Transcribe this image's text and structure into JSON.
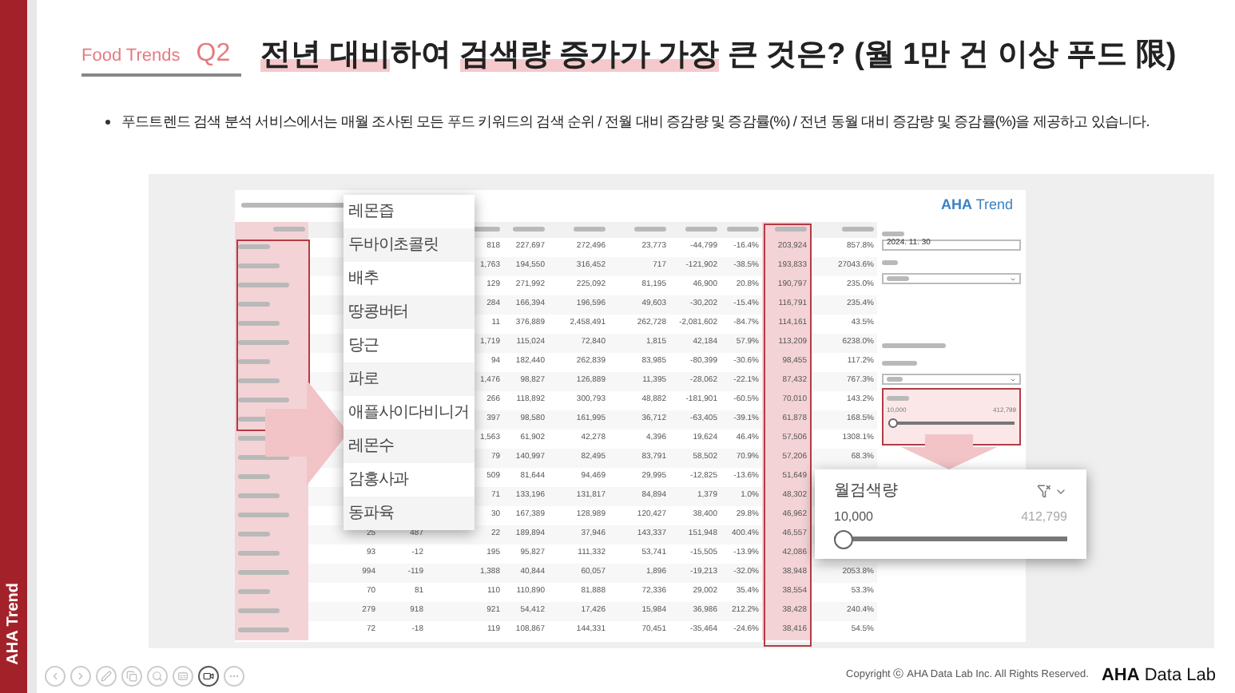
{
  "sidebar": {
    "label": "AHA Trend"
  },
  "header": {
    "category": "Food Trends",
    "question": "Q2",
    "title": [
      {
        "text": "전년 대비",
        "highlighted": true
      },
      {
        "text": "하여 ",
        "highlighted": false
      },
      {
        "text": "검색량 증가가 가장",
        "highlighted": true
      },
      {
        "text": " 큰 것은? (월 1만 건 이상 푸드 限)",
        "highlighted": false
      }
    ]
  },
  "bullet": "푸드트렌드 검색 분석 서비스에서는 매월 조사된 모든 푸드 키워드의 검색 순위 / 전월 대비 증감량 및 증감률(%) / 전년 동월 대비 증감량 및 증감률(%)을 제공하고 있습니다.",
  "screenshot": {
    "brand": "AHA Trend",
    "table": {
      "emphasis": {
        "name_column": true,
        "year_change_column": true
      },
      "rows": [
        {
          "cells": [
            null,
            null,
            "818",
            "227,697",
            "272,496",
            "23,773",
            "-44,799",
            "-16.4%",
            "203,924",
            "857.8%"
          ]
        },
        {
          "cells": [
            null,
            null,
            "1,763",
            "194,550",
            "316,452",
            "717",
            "-121,902",
            "-38.5%",
            "193,833",
            "27043.6%"
          ]
        },
        {
          "cells": [
            null,
            null,
            "129",
            "271,992",
            "225,092",
            "81,195",
            "46,900",
            "20.8%",
            "190,797",
            "235.0%"
          ]
        },
        {
          "cells": [
            null,
            null,
            "284",
            "166,394",
            "196,596",
            "49,603",
            "-30,202",
            "-15.4%",
            "116,791",
            "235.4%"
          ]
        },
        {
          "cells": [
            null,
            null,
            "11",
            "376,889",
            "2,458,491",
            "262,728",
            "-2,081,602",
            "-84.7%",
            "114,161",
            "43.5%"
          ]
        },
        {
          "cells": [
            null,
            null,
            "1,719",
            "115,024",
            "72,840",
            "1,815",
            "42,184",
            "57.9%",
            "113,209",
            "6238.0%"
          ]
        },
        {
          "cells": [
            null,
            null,
            "94",
            "182,440",
            "262,839",
            "83,985",
            "-80,399",
            "-30.6%",
            "98,455",
            "117.2%"
          ]
        },
        {
          "cells": [
            null,
            null,
            "1,476",
            "98,827",
            "126,889",
            "11,395",
            "-28,062",
            "-22.1%",
            "87,432",
            "767.3%"
          ]
        },
        {
          "cells": [
            null,
            null,
            "266",
            "118,892",
            "300,793",
            "48,882",
            "-181,901",
            "-60.5%",
            "70,010",
            "143.2%"
          ]
        },
        {
          "cells": [
            null,
            null,
            "397",
            "98,580",
            "161,995",
            "36,712",
            "-63,405",
            "-39.1%",
            "61,878",
            "168.5%"
          ]
        },
        {
          "cells": [
            null,
            null,
            "1,563",
            "61,902",
            "42,278",
            "4,396",
            "19,624",
            "46.4%",
            "57,506",
            "1308.1%"
          ]
        },
        {
          "cells": [
            null,
            null,
            "79",
            "140,997",
            "82,495",
            "83,791",
            "58,502",
            "70.9%",
            "57,206",
            "68.3%"
          ]
        },
        {
          "cells": [
            null,
            null,
            "509",
            "81,644",
            "94,469",
            "29,995",
            "-12,825",
            "-13.6%",
            "51,649",
            null
          ]
        },
        {
          "cells": [
            null,
            null,
            "71",
            "133,196",
            "131,817",
            "84,894",
            "1,379",
            "1.0%",
            "48,302",
            null
          ]
        },
        {
          "cells": [
            null,
            null,
            "30",
            "167,389",
            "128,989",
            "120,427",
            "38,400",
            "29.8%",
            "46,962",
            null
          ]
        },
        {
          "cells": [
            "25",
            "487",
            "22",
            "189,894",
            "37,946",
            "143,337",
            "151,948",
            "400.4%",
            "46,557",
            null
          ]
        },
        {
          "cells": [
            "93",
            "-12",
            "195",
            "95,827",
            "111,332",
            "53,741",
            "-15,505",
            "-13.9%",
            "42,086",
            null
          ]
        },
        {
          "cells": [
            "994",
            "-119",
            "1,388",
            "40,844",
            "60,057",
            "1,896",
            "-19,213",
            "-32.0%",
            "38,948",
            "2053.8%"
          ]
        },
        {
          "cells": [
            "70",
            "81",
            "110",
            "110,890",
            "81,888",
            "72,336",
            "29,002",
            "35.4%",
            "38,554",
            "53.3%"
          ]
        },
        {
          "cells": [
            "279",
            "918",
            "921",
            "54,412",
            "17,426",
            "15,984",
            "36,986",
            "212.2%",
            "38,428",
            "240.4%"
          ]
        },
        {
          "cells": [
            "72",
            "-18",
            "119",
            "108,867",
            "144,331",
            "70,451",
            "-35,464",
            "-24.6%",
            "38,416",
            "54.5%"
          ]
        }
      ]
    },
    "date_field": {
      "value": "2024. 11. 30"
    },
    "range_filter": {
      "min": "10,000",
      "max": "412,799",
      "level": 0
    }
  },
  "food_list_popup": [
    "레몬즙",
    "두바이초콜릿",
    "배추",
    "땅콩버터",
    "당근",
    "파로",
    "애플사이다비니거",
    "레몬수",
    "감홍사과",
    "동파육"
  ],
  "filter_popup": {
    "title": "월검색량",
    "min": "10,000",
    "max": "412,799",
    "level": 0
  },
  "footer": {
    "copyright": "Copyright ⓒ AHA Data Lab Inc. All Rights Reserved.",
    "logo_bold": "AHA",
    "logo_rest": "Data Lab"
  }
}
